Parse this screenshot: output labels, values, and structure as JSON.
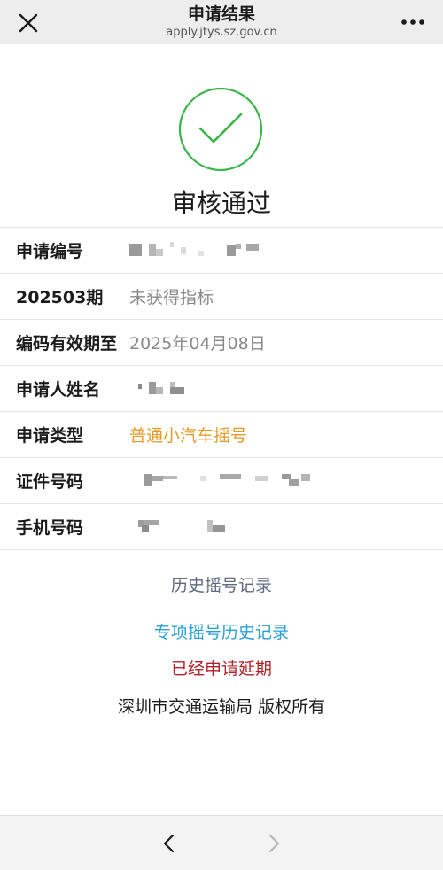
{
  "header": {
    "title": "申请结果",
    "url": "apply.jtys.sz.gov.cn",
    "close_icon": "close-icon",
    "more_icon": "more-dots-icon"
  },
  "result": {
    "status_icon": "check-circle-icon",
    "status_text": "审核通过",
    "status_color": "#3bb54a"
  },
  "info_rows": {
    "application_no": {
      "label": "申请编号"
    },
    "period": {
      "label": "202503期",
      "value": "未获得指标"
    },
    "code_valid_until": {
      "label": "编码有效期至",
      "value": "2025年04月08日"
    },
    "applicant_name": {
      "label": "申请人姓名"
    },
    "application_type": {
      "label": "申请类型",
      "value": "普通小汽车摇号"
    },
    "id_number": {
      "label": "证件号码"
    },
    "phone_number": {
      "label": "手机号码"
    }
  },
  "links": {
    "history": "历史摇号记录",
    "special_history": "专项摇号历史记录",
    "delay_applied": "已经申请延期"
  },
  "footer": {
    "copyright": "深圳市交通运输局 版权所有"
  },
  "bottom_nav": {
    "back_icon": "chevron-left-icon",
    "forward_icon": "chevron-right-icon"
  },
  "colors": {
    "accent_orange": "#e69b25",
    "link_blue": "#2aa0d8",
    "link_gray_blue": "#5e6b80",
    "alert_red": "#b3242a"
  }
}
